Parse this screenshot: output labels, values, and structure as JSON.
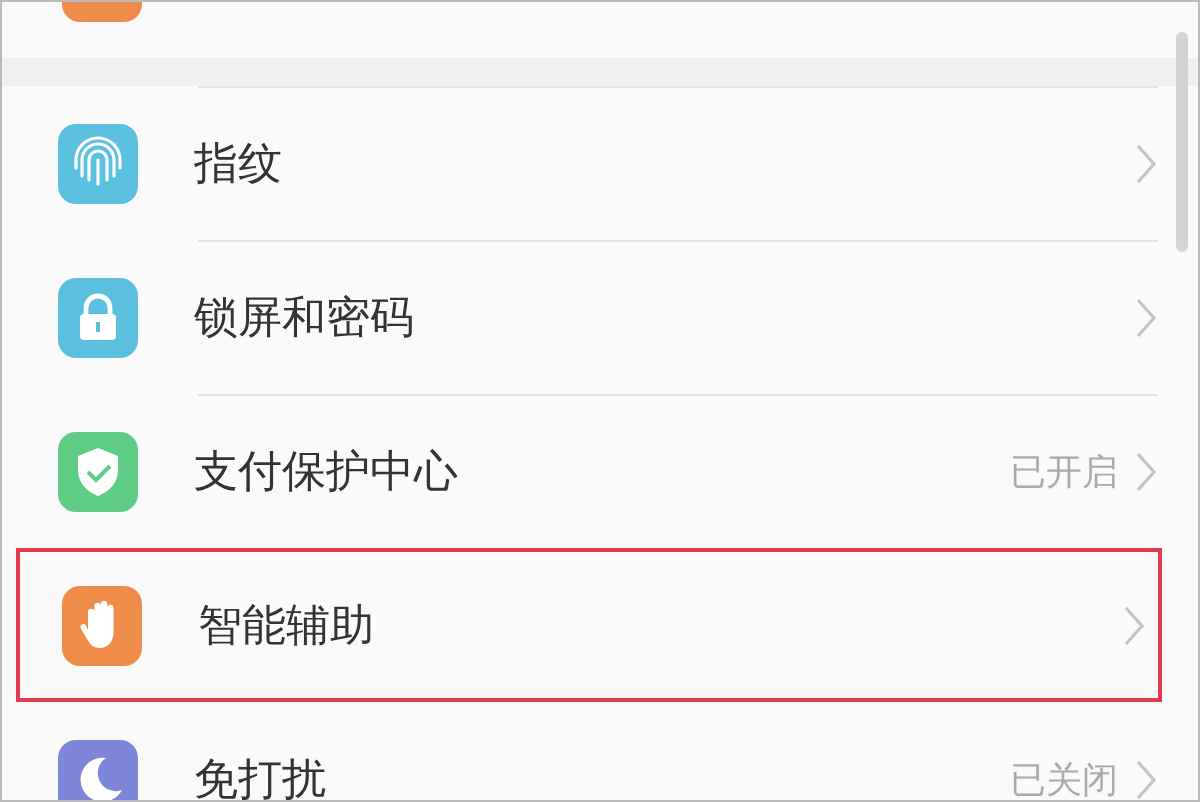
{
  "items": [
    {
      "kind": "fingerprint",
      "label": "指纹",
      "highlighted": false
    },
    {
      "kind": "lock",
      "label": "锁屏和密码",
      "highlighted": false
    },
    {
      "kind": "shield",
      "label": "支付保护中心",
      "status": "已开启",
      "highlighted": false
    },
    {
      "kind": "hand",
      "label": "智能辅助",
      "highlighted": true
    },
    {
      "kind": "moon",
      "label": "免打扰",
      "status": "已关闭",
      "highlighted": false
    }
  ]
}
